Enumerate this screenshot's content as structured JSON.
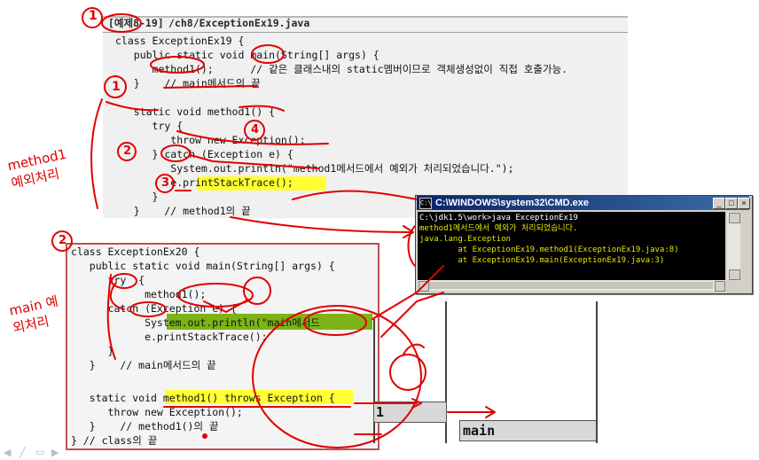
{
  "top_panel": {
    "title_badge": "[예제8-19]",
    "title_path": "/ch8/ExceptionEx19.java",
    "lines": [
      "class ExceptionEx19 {",
      "   public static void main(String[] args) {",
      "      method1();      // 같은 클래스내의 static멤버이므로 객체생성없이 직접 호출가능.",
      "   }    // main메서드의 끝",
      "",
      "   static void method1() {",
      "      try {",
      "         throw new Exception();",
      "      } catch (Exception e) {",
      "         System.out.println(\"method1메서드에서 예외가 처리되었습니다.\");",
      "         e.printStackTrace();",
      "      }",
      "   }    // method1의 끝"
    ]
  },
  "bottom_panel": {
    "lines": [
      "class ExceptionEx20 {",
      "   public static void main(String[] args) {",
      "      try  {",
      "            method1();",
      "      catch (Exception e) {",
      "            System.out.println(\"main메서드",
      "            e.printStackTrace();",
      "      }",
      "   }    // main메서드의 끝",
      "",
      "   static void method1() throws Exception {",
      "      throw new Exception();",
      "   }    // method1()의 끝",
      "} // class의 끝"
    ]
  },
  "console": {
    "title": "C:\\WINDOWS\\system32\\CMD.exe",
    "buttons": [
      "_",
      "□",
      "×"
    ],
    "lines": [
      "C:\\jdk1.5\\work>java ExceptionEx19",
      "method1메서드에서 예외가 처리되었습니다.",
      "java.lang.Exception",
      "        at ExceptionEx19.method1(ExceptionEx19.java:8)",
      "        at ExceptionEx19.main(ExceptionEx19.java:3)"
    ],
    "colors": {
      "prompt": "#ffffff",
      "highlight": "#e8e800",
      "normal": "#e8e800"
    }
  },
  "stack": {
    "top_label": "1",
    "bottom_label": "main"
  },
  "annotations": {
    "circle_numbers": [
      "1",
      "2",
      "3",
      "4"
    ],
    "handwritten_left_top": "method1 예외처리",
    "handwritten_left_bottom": "main 예외처리",
    "color": "#e00000"
  },
  "nav_icons": [
    "back-arrow-icon",
    "forward-arrow-icon",
    "pen-icon",
    "menu-icon"
  ]
}
